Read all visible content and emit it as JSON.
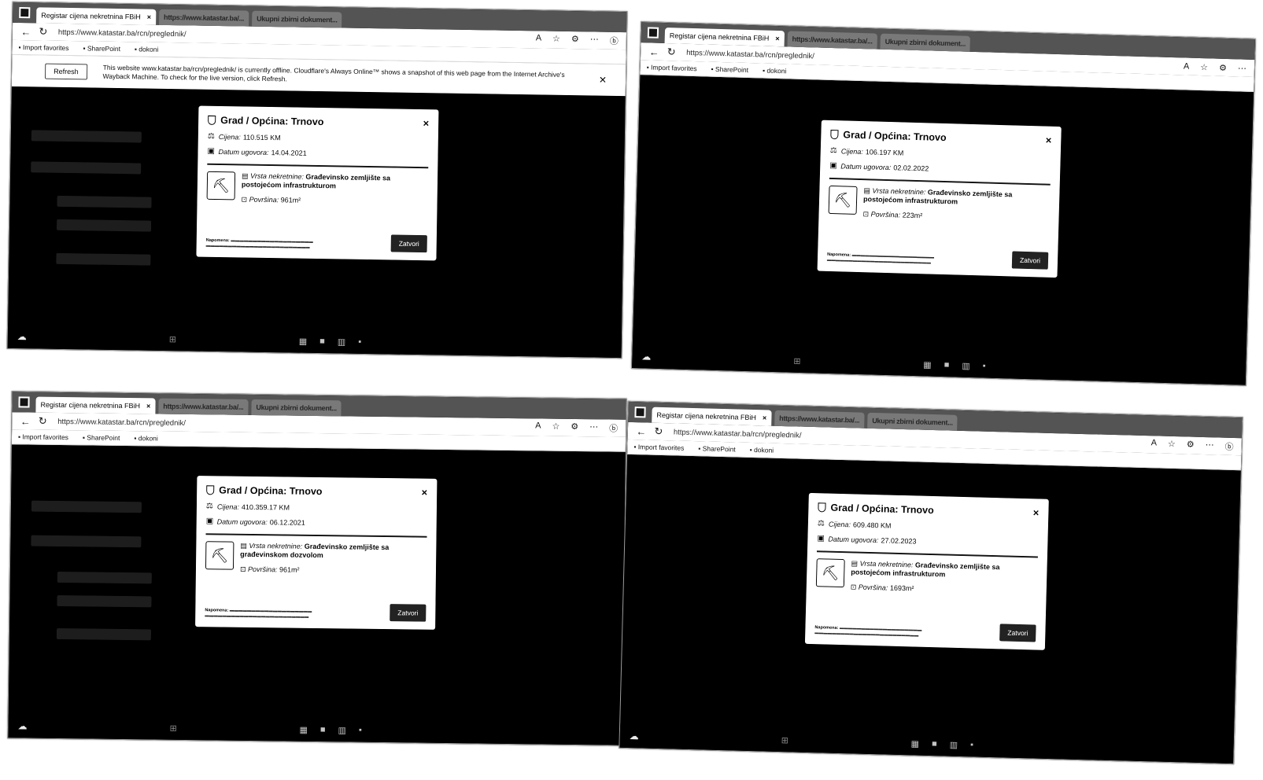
{
  "browser": {
    "active_tab": "Registar cijena nekretnina FBiH",
    "other_tabs": [
      "https://www.katastar.ba/...",
      "Ukupni zbirni dokument..."
    ],
    "url": "https://www.katastar.ba/rcn/preglednik/",
    "favorites": [
      "Import favorites",
      "SharePoint",
      "dokoni"
    ]
  },
  "notice": {
    "refresh_label": "Refresh",
    "text": "This website www.katastar.ba/rcn/preglednik/ is currently offline. Cloudflare's Always Online™ shows a snapshot of this web page from the Internet Archive's Wayback Machine. To check for the live version, click Refresh."
  },
  "modal_labels": {
    "cijena": "Cijena:",
    "datum": "Datum ugovora:",
    "vrsta": "Vrsta nekretnine:",
    "povrsina": "Površina:",
    "close": "Zatvori",
    "note_label": "Napomena:"
  },
  "screens": [
    {
      "title": "Grad / Općina: Trnovo",
      "cijena": "110.515 KM",
      "datum": "14.04.2021",
      "vrsta": "Građevinsko zemljište sa postojećom infrastrukturom",
      "povrsina": "961m²"
    },
    {
      "title": "Grad / Općina: Trnovo",
      "cijena": "106.197 KM",
      "datum": "02.02.2022",
      "vrsta": "Građevinsko zemljište sa postojećom infrastrukturom",
      "povrsina": "223m²"
    },
    {
      "title": "Grad / Općina: Trnovo",
      "cijena": "410.359.17 KM",
      "datum": "06.12.2021",
      "vrsta": "Građevinsko zemljište sa građevinskom dozvolom",
      "povrsina": "961m²"
    },
    {
      "title": "Grad / Općina: Trnovo",
      "cijena": "609.480 KM",
      "datum": "27.02.2023",
      "vrsta": "Građevinsko zemljište sa postojećom infrastrukturom",
      "povrsina": "1693m²"
    }
  ],
  "icons": [
    "shield-icon",
    "money-icon",
    "calendar-icon",
    "crane-icon",
    "building-icon",
    "area-icon",
    "close-icon"
  ]
}
